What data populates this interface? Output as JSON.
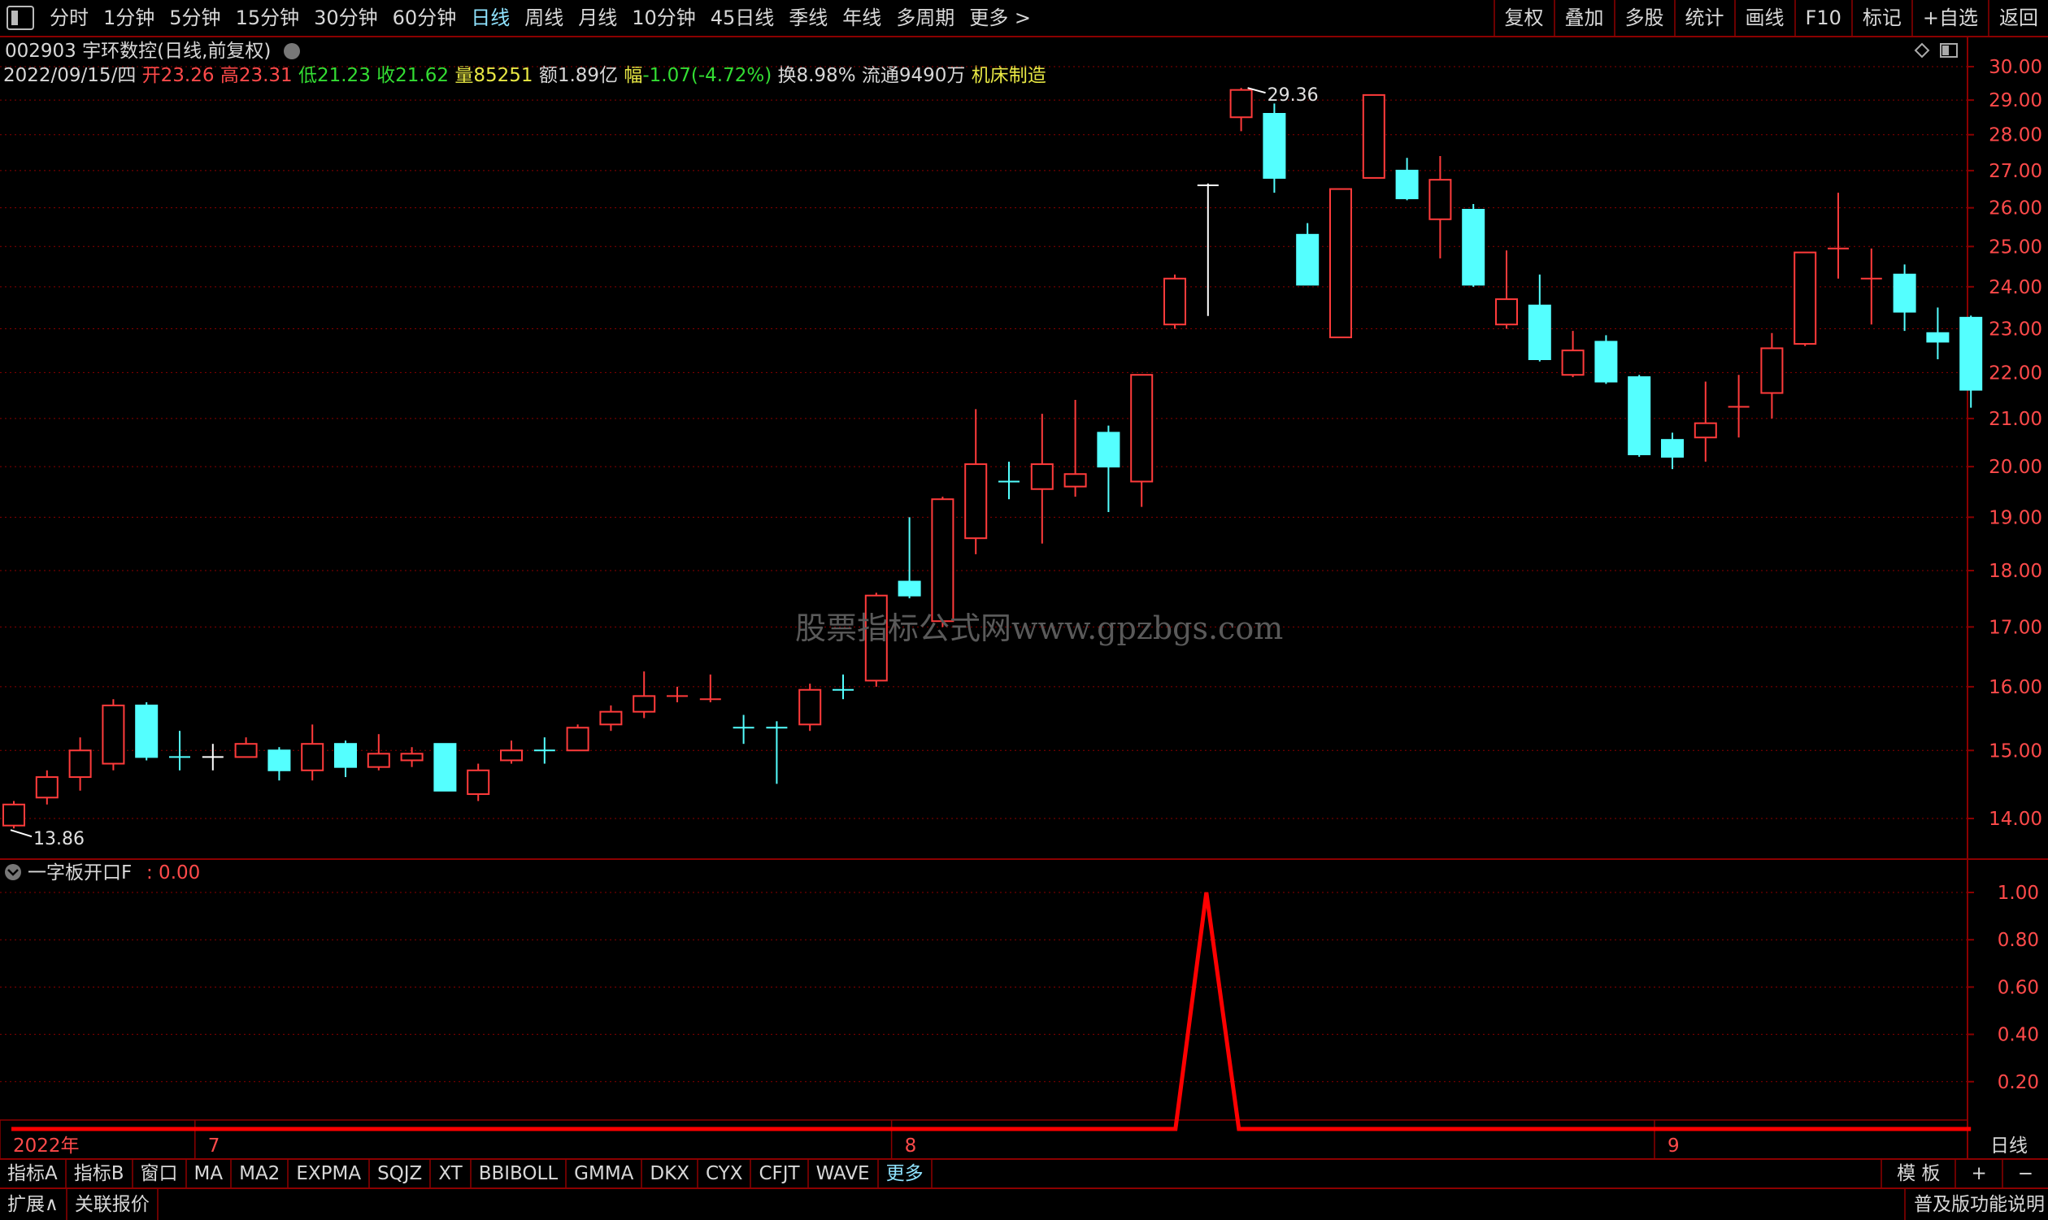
{
  "topbar": {
    "items": [
      "分时",
      "1分钟",
      "5分钟",
      "15分钟",
      "30分钟",
      "60分钟",
      "日线",
      "周线",
      "月线",
      "10分钟",
      "45日线",
      "季线",
      "年线",
      "多周期",
      "更多 >"
    ],
    "active_index": 6,
    "right_buttons": [
      "复权",
      "叠加",
      "多股",
      "统计",
      "画线",
      "F10",
      "标记",
      "+自选",
      "返回"
    ]
  },
  "stock": {
    "code": "002903",
    "name": "宇环数控",
    "mode": "(日线,前复权)",
    "date": "2022/09/15/四",
    "open_label": "开",
    "open": "23.26",
    "high_label": "高",
    "high": "23.31",
    "low_label": "低",
    "low": "21.23",
    "close_label": "收",
    "close": "21.62",
    "vol_label": "量",
    "vol": "85251",
    "amt_label": "额",
    "amt": "1.89亿",
    "chg_label": "幅",
    "chg": "-1.07(-4.72%)",
    "turnover_label": "换",
    "turnover": "8.98%",
    "float_label": "流通",
    "float": "9490万",
    "industry": "机床制造"
  },
  "watermark": "股票指标公式网www.gpzbgs.com",
  "main_chart_labels": {
    "high_mark": "29.36",
    "low_mark": "13.86"
  },
  "indicator": {
    "name": "一字板开口F",
    "value": ": 0.00"
  },
  "colors": {
    "up": "#ff3b3b",
    "down": "#54ffff",
    "doji_white": "#ffffff",
    "grid": "#8b0000",
    "axis_text": "#ff4a4a",
    "indicator_line": "#ff0000"
  },
  "chart_data": [
    {
      "type": "candlestick",
      "title": "",
      "yticks": [
        30.0,
        29.0,
        28.0,
        27.0,
        26.0,
        25.0,
        24.0,
        23.0,
        22.0,
        21.0,
        20.0,
        19.0,
        18.0,
        17.0,
        16.0,
        15.0,
        14.0
      ],
      "ylim": [
        13.5,
        30.5
      ],
      "log_scale": true,
      "x_labels": [
        {
          "index": 0,
          "label": "2022年"
        },
        {
          "index": 6,
          "label": "7"
        },
        {
          "index": 27,
          "label": "8"
        },
        {
          "index": 50,
          "label": "9"
        }
      ],
      "candles": [
        {
          "o": 13.9,
          "c": 14.2,
          "h": 14.25,
          "l": 13.86
        },
        {
          "o": 14.3,
          "c": 14.6,
          "h": 14.7,
          "l": 14.2
        },
        {
          "o": 14.6,
          "c": 15.0,
          "h": 15.2,
          "l": 14.4
        },
        {
          "o": 14.8,
          "c": 15.7,
          "h": 15.8,
          "l": 14.7
        },
        {
          "o": 15.7,
          "c": 14.9,
          "h": 15.75,
          "l": 14.85
        },
        {
          "o": 14.9,
          "c": 14.9,
          "h": 15.3,
          "l": 14.7,
          "doji": "down"
        },
        {
          "o": 14.9,
          "c": 14.9,
          "h": 15.1,
          "l": 14.7,
          "doji": "white"
        },
        {
          "o": 14.9,
          "c": 15.1,
          "h": 15.2,
          "l": 14.9
        },
        {
          "o": 15.0,
          "c": 14.7,
          "h": 15.05,
          "l": 14.55
        },
        {
          "o": 14.7,
          "c": 15.1,
          "h": 15.4,
          "l": 14.55
        },
        {
          "o": 15.1,
          "c": 14.75,
          "h": 15.15,
          "l": 14.6
        },
        {
          "o": 14.75,
          "c": 14.95,
          "h": 15.25,
          "l": 14.7
        },
        {
          "o": 14.85,
          "c": 14.95,
          "h": 15.05,
          "l": 14.75
        },
        {
          "o": 15.1,
          "c": 14.4,
          "h": 15.1,
          "l": 14.4
        },
        {
          "o": 14.35,
          "c": 14.7,
          "h": 14.8,
          "l": 14.25
        },
        {
          "o": 14.85,
          "c": 15.0,
          "h": 15.15,
          "l": 14.8
        },
        {
          "o": 15.0,
          "c": 15.0,
          "h": 15.2,
          "l": 14.8,
          "doji": "down"
        },
        {
          "o": 15.0,
          "c": 15.35,
          "h": 15.4,
          "l": 15.0
        },
        {
          "o": 15.4,
          "c": 15.6,
          "h": 15.7,
          "l": 15.3
        },
        {
          "o": 15.6,
          "c": 15.85,
          "h": 16.25,
          "l": 15.5
        },
        {
          "o": 15.85,
          "c": 15.85,
          "h": 16.0,
          "l": 15.75,
          "doji": "up"
        },
        {
          "o": 15.8,
          "c": 15.8,
          "h": 16.2,
          "l": 15.75,
          "doji": "up"
        },
        {
          "o": 15.35,
          "c": 15.35,
          "h": 15.55,
          "l": 15.1,
          "doji": "down"
        },
        {
          "o": 15.35,
          "c": 15.35,
          "h": 15.45,
          "l": 14.5,
          "doji": "down"
        },
        {
          "o": 15.4,
          "c": 15.95,
          "h": 16.05,
          "l": 15.3
        },
        {
          "o": 15.95,
          "c": 15.95,
          "h": 16.2,
          "l": 15.8,
          "doji": "down"
        },
        {
          "o": 16.1,
          "c": 17.55,
          "h": 17.6,
          "l": 16.0
        },
        {
          "o": 17.8,
          "c": 17.55,
          "h": 19.0,
          "l": 17.5
        },
        {
          "o": 17.1,
          "c": 19.35,
          "h": 19.4,
          "l": 17.0
        },
        {
          "o": 18.6,
          "c": 20.05,
          "h": 21.2,
          "l": 18.3
        },
        {
          "o": 19.7,
          "c": 19.7,
          "h": 20.1,
          "l": 19.35,
          "doji": "down"
        },
        {
          "o": 19.55,
          "c": 20.05,
          "h": 21.1,
          "l": 18.5
        },
        {
          "o": 19.6,
          "c": 19.85,
          "h": 21.4,
          "l": 19.4
        },
        {
          "o": 20.7,
          "c": 20.0,
          "h": 20.85,
          "l": 19.1
        },
        {
          "o": 19.7,
          "c": 21.95,
          "h": 21.95,
          "l": 19.2
        },
        {
          "o": 23.1,
          "c": 24.2,
          "h": 24.3,
          "l": 23.0
        },
        {
          "o": 26.6,
          "c": 26.6,
          "h": 26.65,
          "l": 23.3,
          "doji": "white"
        },
        {
          "o": 28.5,
          "c": 29.3,
          "h": 29.36,
          "l": 28.1
        },
        {
          "o": 28.6,
          "c": 26.8,
          "h": 28.9,
          "l": 26.4
        },
        {
          "o": 25.3,
          "c": 24.05,
          "h": 25.6,
          "l": 24.05
        },
        {
          "o": 22.8,
          "c": 26.5,
          "h": 26.5,
          "l": 22.8
        },
        {
          "o": 26.8,
          "c": 29.15,
          "h": 29.15,
          "l": 26.8
        },
        {
          "o": 27.0,
          "c": 26.25,
          "h": 27.35,
          "l": 26.2
        },
        {
          "o": 25.7,
          "c": 26.75,
          "h": 27.4,
          "l": 24.7
        },
        {
          "o": 25.95,
          "c": 24.05,
          "h": 26.1,
          "l": 24.0
        },
        {
          "o": 23.1,
          "c": 23.7,
          "h": 24.9,
          "l": 23.0
        },
        {
          "o": 23.55,
          "c": 22.3,
          "h": 24.3,
          "l": 22.25
        },
        {
          "o": 21.95,
          "c": 22.5,
          "h": 22.95,
          "l": 21.9
        },
        {
          "o": 22.7,
          "c": 21.8,
          "h": 22.85,
          "l": 21.75
        },
        {
          "o": 21.9,
          "c": 20.25,
          "h": 21.95,
          "l": 20.2
        },
        {
          "o": 20.55,
          "c": 20.2,
          "h": 20.7,
          "l": 19.95
        },
        {
          "o": 20.6,
          "c": 20.9,
          "h": 21.8,
          "l": 20.1
        },
        {
          "o": 21.25,
          "c": 21.25,
          "h": 21.95,
          "l": 20.6,
          "doji": "up"
        },
        {
          "o": 21.55,
          "c": 22.55,
          "h": 22.9,
          "l": 21.0
        },
        {
          "o": 22.65,
          "c": 24.85,
          "h": 24.85,
          "l": 22.6
        },
        {
          "o": 24.95,
          "c": 24.95,
          "h": 26.4,
          "l": 24.2,
          "doji": "up"
        },
        {
          "o": 24.2,
          "c": 24.2,
          "h": 24.95,
          "l": 23.1,
          "doji": "up"
        },
        {
          "o": 24.3,
          "c": 23.4,
          "h": 24.55,
          "l": 22.95
        },
        {
          "o": 22.9,
          "c": 22.7,
          "h": 23.5,
          "l": 22.3
        },
        {
          "o": 23.26,
          "c": 21.62,
          "h": 23.31,
          "l": 21.23
        }
      ]
    },
    {
      "type": "line",
      "title": "一字板开口F",
      "yticks": [
        1.0,
        0.8,
        0.6,
        0.4,
        0.2
      ],
      "ylim": [
        -0.1,
        1.1
      ],
      "values": [
        0,
        0,
        0,
        0,
        0,
        0,
        0,
        0,
        0,
        0,
        0,
        0,
        0,
        0,
        0,
        0,
        0,
        0,
        0,
        0,
        0,
        0,
        0,
        0,
        0,
        0,
        0,
        0,
        0,
        0,
        0,
        0,
        0,
        0,
        0,
        0,
        1,
        0,
        0,
        0,
        0,
        0,
        0,
        0,
        0,
        0,
        0,
        0,
        0,
        0,
        0,
        0,
        0,
        0,
        0,
        0,
        0,
        0,
        0,
        0
      ]
    }
  ],
  "tabs": [
    "指标A",
    "指标B",
    "窗口",
    "MA",
    "MA2",
    "EXPMA",
    "SQJZ",
    "XT",
    "BBIBOLL",
    "GMMA",
    "DKX",
    "CYX",
    "CFJT",
    "WAVE",
    "更多"
  ],
  "tabs_right": [
    "模 板",
    "+",
    "−"
  ],
  "bottom_right_label": "日线",
  "status": {
    "left": [
      "扩展∧",
      "关联报价"
    ],
    "right": "普及版功能说明"
  }
}
